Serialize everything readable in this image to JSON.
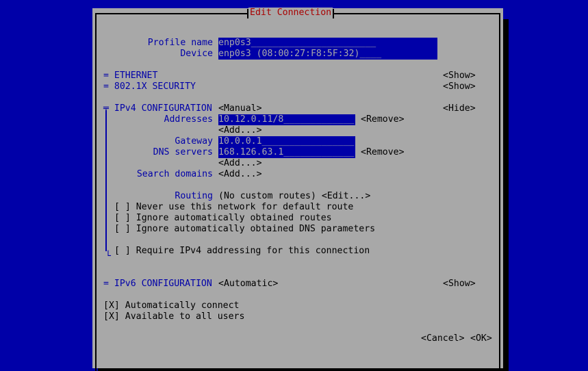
{
  "dialog": {
    "title": "Edit Connection",
    "profile_name_label": "Profile name",
    "profile_name_value": "enp0s3_______________________",
    "device_label": "Device",
    "device_value": "enp0s3 (08:00:27:F8:5F:32)____",
    "ethernet": "= ETHERNET",
    "ethernet_toggle": "<Show>",
    "security": "= 802.1X SECURITY",
    "security_toggle": "<Show>",
    "ipv4": {
      "heading": "╤ IPv4 CONFIGURATION",
      "method": "<Manual>",
      "toggle": "<Hide>",
      "addresses_label": "Addresses",
      "address_value": "10.12.0.11/8_____________",
      "address_remove": "<Remove>",
      "address_add": "<Add...>",
      "gateway_label": "Gateway",
      "gateway_value": "10.0.0.1_________________",
      "dns_label": "DNS servers",
      "dns_value": "168.126.63.1_____________",
      "dns_remove": "<Remove>",
      "dns_add": "<Add...>",
      "search_label": "Search domains",
      "search_add": "<Add...>",
      "routing_label": "Routing",
      "routing_value": "(No custom routes) <Edit...>",
      "never_default": "[ ] Never use this network for default route",
      "ignore_routes": "[ ] Ignore automatically obtained routes",
      "ignore_dns": "[ ] Ignore automatically obtained DNS parameters",
      "require": "[ ] Require IPv4 addressing for this connection",
      "end_mark": "└"
    },
    "ipv6": {
      "heading": "= IPv6 CONFIGURATION",
      "method": "<Automatic>",
      "toggle": "<Show>"
    },
    "auto_connect": "[X] Automatically connect",
    "all_users": "[X] Available to all users",
    "cancel": "<Cancel>",
    "ok": "<OK>"
  }
}
